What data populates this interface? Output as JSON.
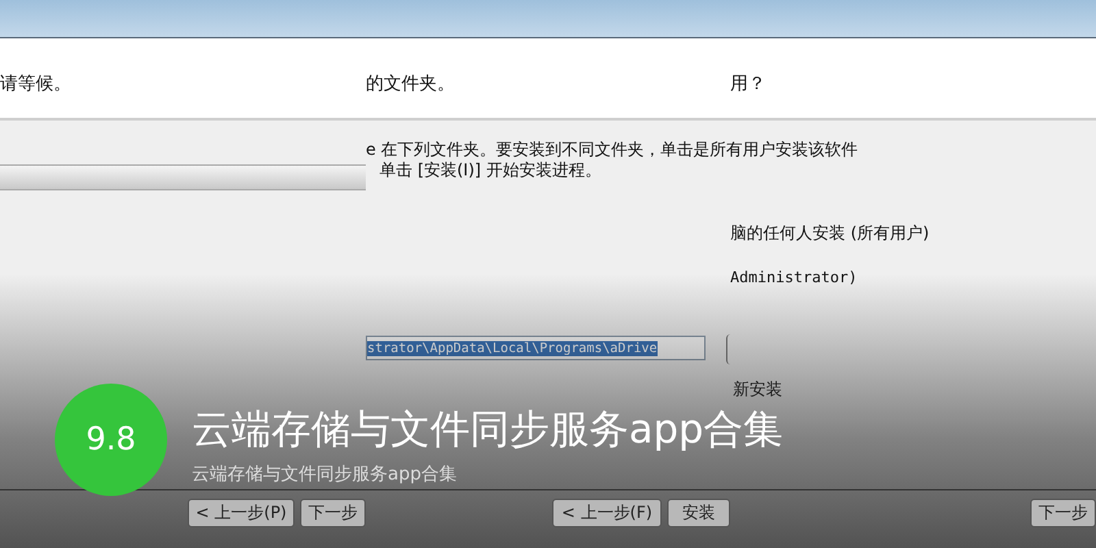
{
  "header_texts": [
    "请等候。",
    "的文件夹。",
    "用？"
  ],
  "install_notes": [
    "e 在下列文件夹。要安装到不同文件夹，单击是所有用户安装该软件",
    "单击 [安装(I)] 开始安装进程。"
  ],
  "options": [
    "脑的任何人安装 (所有用户)",
    "Administrator)"
  ],
  "path_field": {
    "value": "strator\\AppData\\Local\\Programs\\aDrive"
  },
  "reinstall_note": "新安装",
  "progress": {
    "level": 1
  },
  "buttons": [
    "< 上一步(P)",
    "下一步",
    "< 上一步(F)",
    "安装",
    "下一步"
  ],
  "rating": {
    "score": "9.8"
  },
  "title": "云端存储与文件同步服务app合集",
  "subtitle": "云端存储与文件同步服务app合集"
}
